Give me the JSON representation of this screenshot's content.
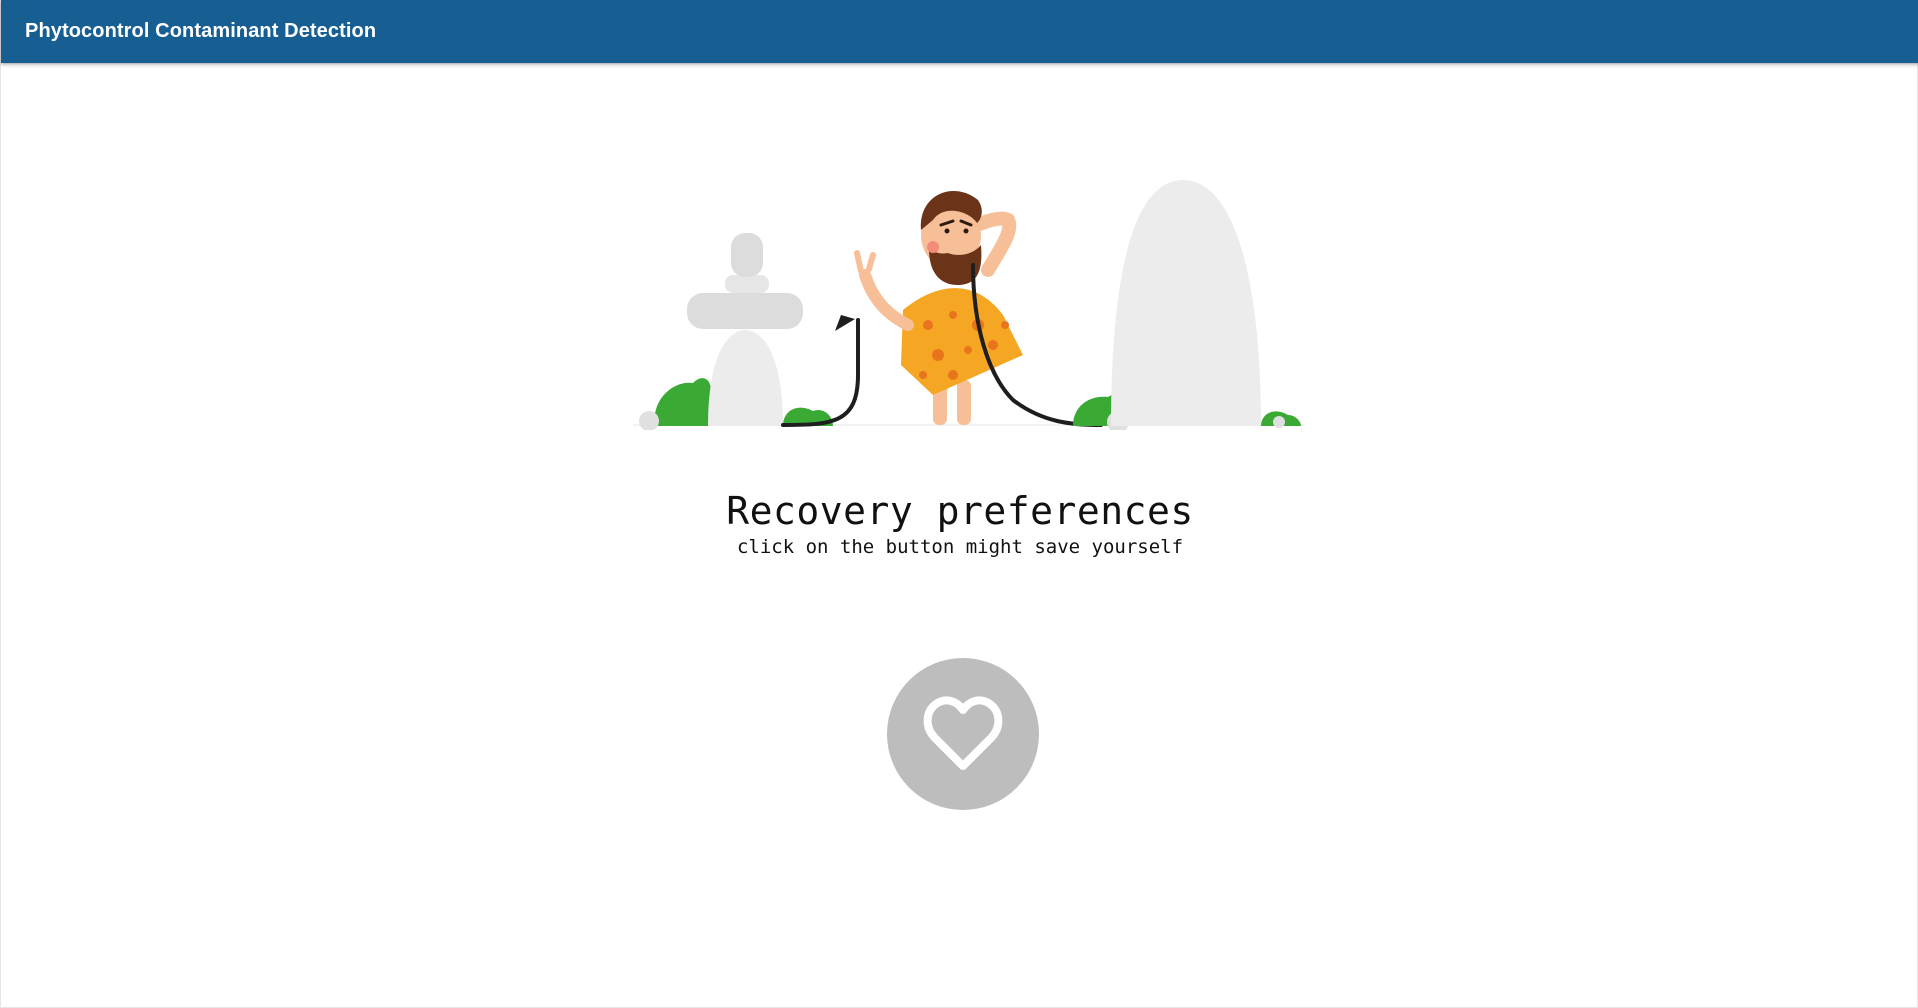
{
  "app_bar": {
    "title": "Phytocontrol Contaminant Detection",
    "color": "#175e93"
  },
  "main": {
    "illustration": "caveman-with-unplugged-cable",
    "title": "Recovery preferences",
    "subtitle": "click on the button might save yourself",
    "action_button": {
      "icon": "heart-outline-icon",
      "color": "#bdbdbd"
    }
  }
}
